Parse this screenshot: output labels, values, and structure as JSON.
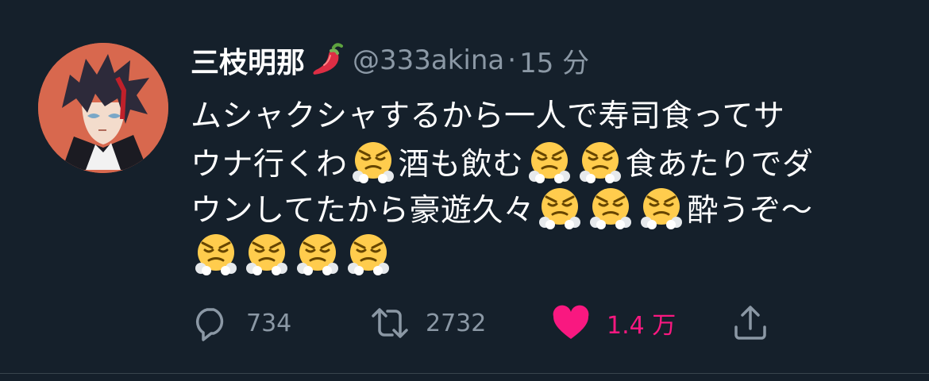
{
  "user": {
    "display_name": "三枝明那",
    "handle": "@333akina",
    "separator": "·",
    "time": "15 分",
    "avatar_icon": "avatar-portrait",
    "name_emoji": "hot-pepper-icon"
  },
  "tweet": {
    "lines": [
      "ムシャクシャするから一人で寿司食ってサ",
      "ウナ行くわ😤酒も飲む😤😤食あたりでダ",
      "ウンしてたから豪遊久々😤😤😤酔うぞ〜",
      "😤😤😤😤"
    ],
    "segments": {
      "l1": "ムシャクシャするから一人で寿司食ってサ",
      "l2a": "ウナ行くわ",
      "l2b": "酒も飲む",
      "l2c": "食あたりでダ",
      "l3a": "ウンしてたから豪遊久々",
      "l3b": "酔うぞ〜"
    },
    "emoji_name": "face-with-steam-from-nose"
  },
  "actions": {
    "reply": {
      "icon": "reply-icon",
      "count": "734"
    },
    "retweet": {
      "icon": "retweet-icon",
      "count": "2732"
    },
    "like": {
      "icon": "heart-icon",
      "count": "1.4 万",
      "active": true
    },
    "share": {
      "icon": "share-icon"
    }
  },
  "colors": {
    "background": "#15202b",
    "text": "#ffffff",
    "secondary": "#8b98a5",
    "like": "#f91880",
    "divider": "#38444d"
  }
}
